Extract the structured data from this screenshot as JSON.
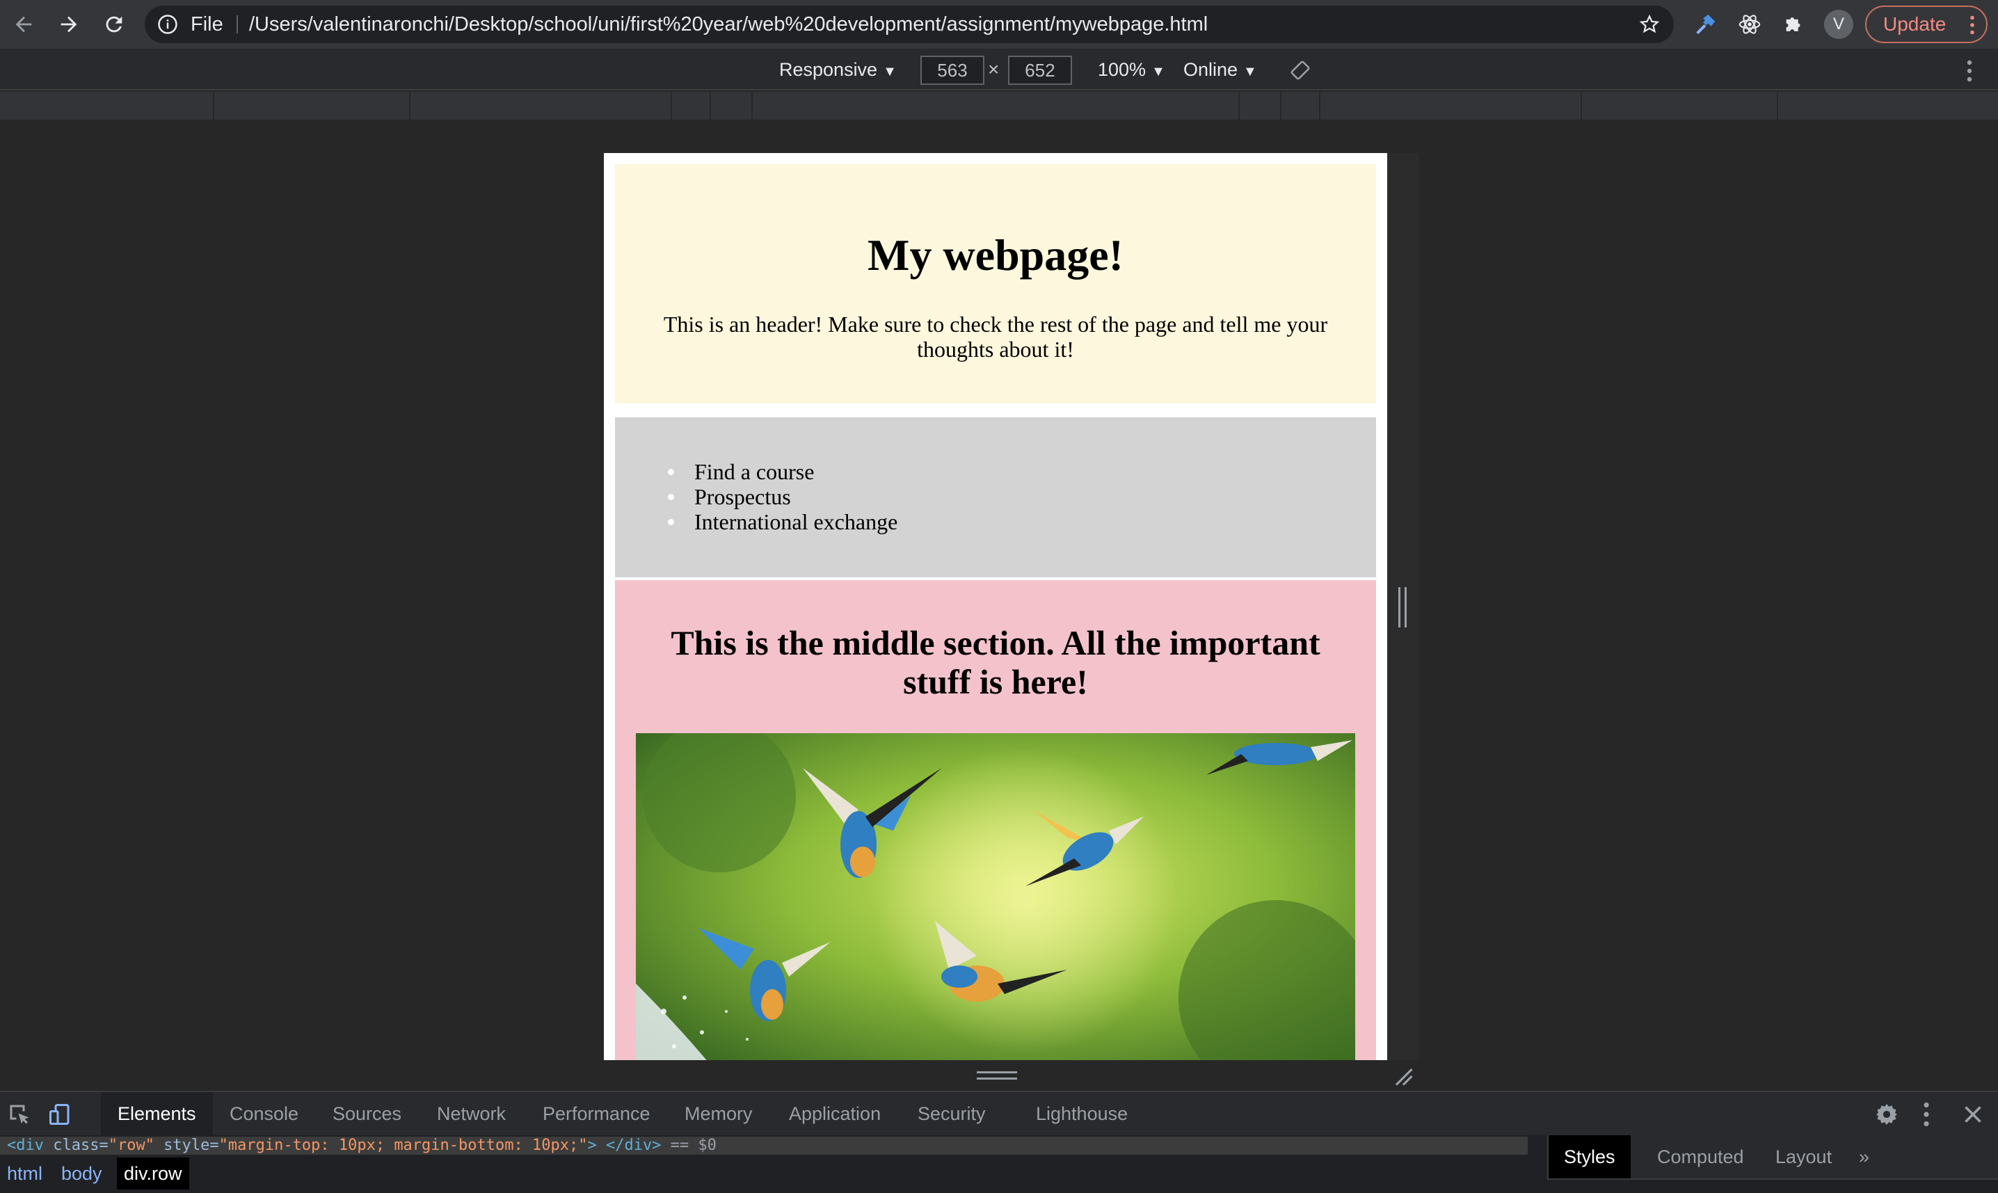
{
  "browser": {
    "omnibox": {
      "scheme_label": "File",
      "url": "/Users/valentinaronchi/Desktop/school/uni/first%20year/web%20development/assignment/mywebpage.html"
    },
    "avatar_letter": "V",
    "update_label": "Update"
  },
  "device_toolbar": {
    "device": "Responsive",
    "width": "563",
    "height": "652",
    "times": "×",
    "zoom": "100%",
    "network": "Online"
  },
  "page": {
    "header_title": "My webpage!",
    "header_text": "This is an header! Make sure to check the rest of the page and tell me your thoughts about it!",
    "nav_items": [
      "Find a course",
      "Prospectus",
      "International exchange"
    ],
    "middle_heading": "This is the middle section. All the important stuff is here!"
  },
  "devtools": {
    "tabs": [
      "Elements",
      "Console",
      "Sources",
      "Network",
      "Performance",
      "Memory",
      "Application",
      "Security",
      "Lighthouse"
    ],
    "code_line": {
      "open": "<div",
      "attr1": " class=",
      "val1": "\"row\"",
      "attr2": " style=",
      "val2": "\"margin-top: 10px; margin-bottom: 10px;\"",
      "close": "> </div>",
      "suffix": " == $0"
    },
    "breadcrumbs": [
      "html",
      "body",
      "div.row"
    ],
    "side_tabs": [
      "Styles",
      "Computed",
      "Layout"
    ],
    "more_glyph": "»"
  },
  "colors": {
    "header_bg": "#fdf7dd",
    "nav_bg": "#d3d3d3",
    "middle_bg": "#f4c2cb",
    "update_accent": "#f28b82"
  }
}
